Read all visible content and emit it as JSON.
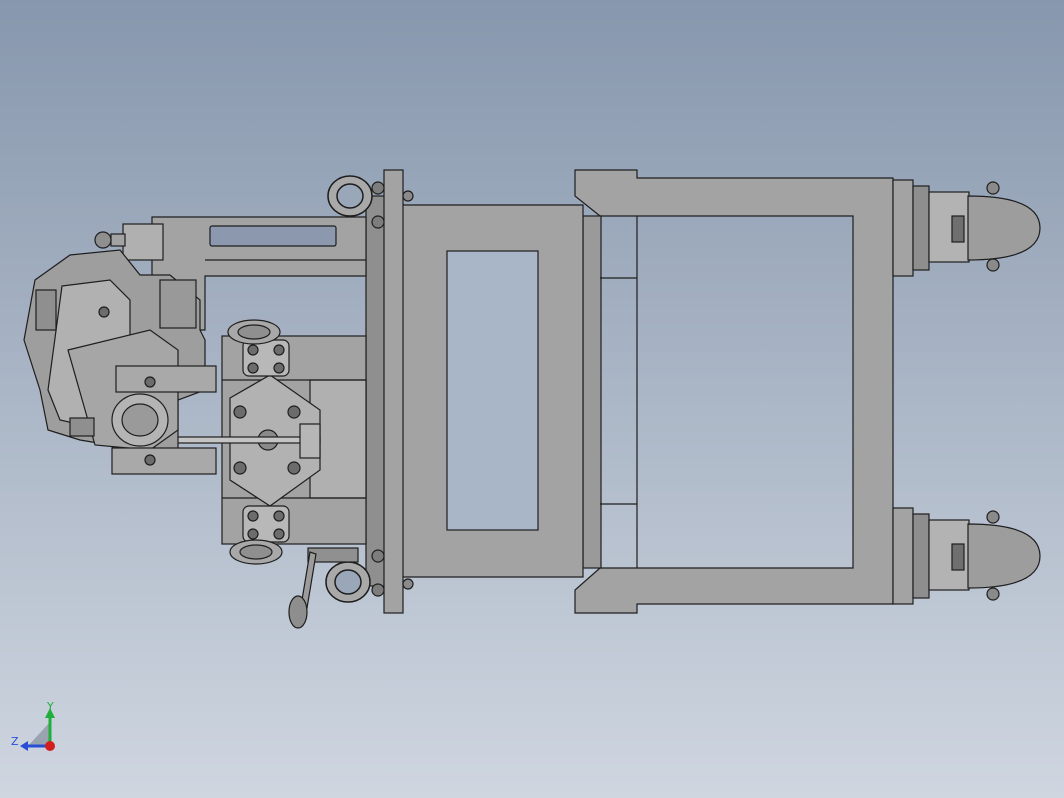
{
  "viewport": {
    "background_top": "#8797ad",
    "background_bottom": "#cfd6e0"
  },
  "model": {
    "body_color": "#a3a3a3",
    "edge_color": "#1e1e1e",
    "dark_part_color": "#7a7a7a"
  },
  "triad": {
    "y_label": "Y",
    "z_label": "Z",
    "y_color": "#1fae3a",
    "z_color": "#2a4fd6",
    "origin_color": "#d41e1e"
  }
}
